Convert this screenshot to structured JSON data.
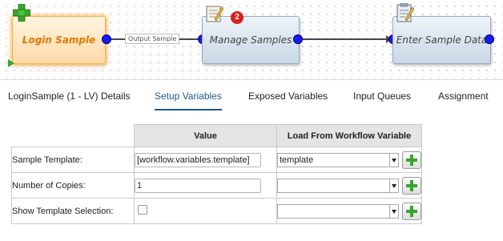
{
  "workflow": {
    "nodes": [
      {
        "label": "Login Sample",
        "state": "selected",
        "icon": "green-plus-icon"
      },
      {
        "label": "Manage Samples",
        "badge": "2",
        "icon": "notepad-pencil-icon"
      },
      {
        "label": "Enter Sample Data",
        "icon": "clipboard-pencil-icon"
      }
    ],
    "connections": [
      {
        "label": "Output Sample"
      }
    ]
  },
  "tabs": [
    {
      "label": "LoginSample (1 - LV) Details",
      "active": false
    },
    {
      "label": "Setup Variables",
      "active": true
    },
    {
      "label": "Exposed Variables",
      "active": false
    },
    {
      "label": "Input Queues",
      "active": false
    },
    {
      "label": "Assignment",
      "active": false
    }
  ],
  "table": {
    "headers": {
      "value": "Value",
      "load": "Load From Workflow Variable"
    },
    "rows": [
      {
        "label": "Sample Template:",
        "value": "[workflow.variables.template]",
        "load": "template",
        "type": "text"
      },
      {
        "label": "Number of Copies:",
        "value": "1",
        "load": "",
        "type": "text"
      },
      {
        "label": "Show Template Selection:",
        "value": "",
        "load": "",
        "type": "checkbox",
        "checked": false
      }
    ]
  },
  "colors": {
    "accent": "#1b5a8c",
    "port": "#1a1aff",
    "selected_node": "#e07800",
    "badge": "#d9211c",
    "add_icon": "#3aa52e"
  }
}
